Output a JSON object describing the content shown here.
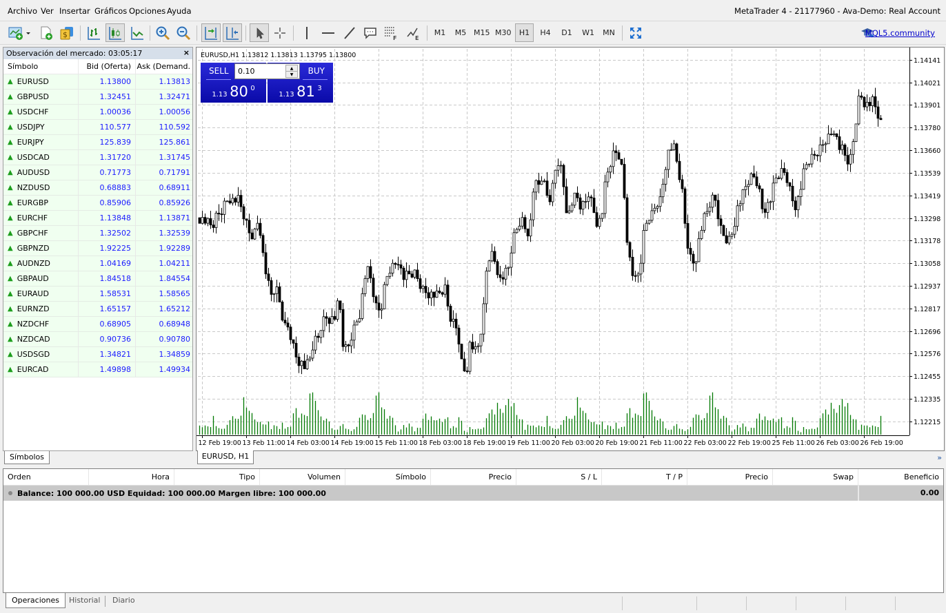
{
  "window": {
    "title": "MetaTrader 4 - 21177960 - Ava-Demo: Real Account"
  },
  "menu": [
    "Archivo",
    "Ver",
    "Insertar",
    "Gráficos",
    "Opciones",
    "Ayuda"
  ],
  "toolbar": {
    "icons": [
      "new-chart-icon",
      "new-profile-icon",
      "market-watch-icon",
      "bar-chart-icon",
      "candlestick-icon",
      "line-chart-icon",
      "zoom-in-icon",
      "zoom-out-icon",
      "auto-scroll-icon",
      "chart-shift-icon",
      "cursor-icon",
      "crosshair-icon",
      "vertical-line-icon",
      "horizontal-line-icon",
      "trendline-icon",
      "text-label-icon",
      "fibonacci-icon",
      "elliott-icon",
      "fullscreen-icon"
    ],
    "timeframes": [
      "M1",
      "M5",
      "M15",
      "M30",
      "H1",
      "H4",
      "D1",
      "W1",
      "MN"
    ],
    "active_timeframe": "H1",
    "community_link": "MQL5.community"
  },
  "market_watch": {
    "title": "Observación del mercado: 03:05:17",
    "close": "×",
    "columns": [
      "Símbolo",
      "Bid (Oferta)",
      "Ask (Demand."
    ],
    "rows": [
      {
        "symbol": "EURUSD",
        "bid": "1.13800",
        "ask": "1.13813"
      },
      {
        "symbol": "GBPUSD",
        "bid": "1.32451",
        "ask": "1.32471"
      },
      {
        "symbol": "USDCHF",
        "bid": "1.00036",
        "ask": "1.00056"
      },
      {
        "symbol": "USDJPY",
        "bid": "110.577",
        "ask": "110.592"
      },
      {
        "symbol": "EURJPY",
        "bid": "125.839",
        "ask": "125.861"
      },
      {
        "symbol": "USDCAD",
        "bid": "1.31720",
        "ask": "1.31745"
      },
      {
        "symbol": "AUDUSD",
        "bid": "0.71773",
        "ask": "0.71791"
      },
      {
        "symbol": "NZDUSD",
        "bid": "0.68883",
        "ask": "0.68911"
      },
      {
        "symbol": "EURGBP",
        "bid": "0.85906",
        "ask": "0.85926"
      },
      {
        "symbol": "EURCHF",
        "bid": "1.13848",
        "ask": "1.13871"
      },
      {
        "symbol": "GBPCHF",
        "bid": "1.32502",
        "ask": "1.32539"
      },
      {
        "symbol": "GBPNZD",
        "bid": "1.92225",
        "ask": "1.92289"
      },
      {
        "symbol": "AUDNZD",
        "bid": "1.04169",
        "ask": "1.04211"
      },
      {
        "symbol": "GBPAUD",
        "bid": "1.84518",
        "ask": "1.84554"
      },
      {
        "symbol": "EURAUD",
        "bid": "1.58531",
        "ask": "1.58565"
      },
      {
        "symbol": "EURNZD",
        "bid": "1.65157",
        "ask": "1.65212"
      },
      {
        "symbol": "NZDCHF",
        "bid": "0.68905",
        "ask": "0.68948"
      },
      {
        "symbol": "NZDCAD",
        "bid": "0.90736",
        "ask": "0.90780"
      },
      {
        "symbol": "USDSGD",
        "bid": "1.34821",
        "ask": "1.34859"
      },
      {
        "symbol": "EURCAD",
        "bid": "1.49898",
        "ask": "1.49934"
      }
    ],
    "tab": "Símbolos"
  },
  "chart": {
    "tab": "EURUSD, H1",
    "ohlc_label": "EURUSD,H1  1.13812 1.13813 1.13795 1.13800",
    "one_click": {
      "sell_label": "SELL",
      "buy_label": "BUY",
      "lot": "0.10",
      "sell_prefix": "1.13",
      "sell_big": "80",
      "sell_sup": "0",
      "buy_prefix": "1.13",
      "buy_big": "81",
      "buy_sup": "3"
    },
    "more": "»"
  },
  "chart_data": {
    "type": "candlestick",
    "title": "EURUSD,H1",
    "ylim": [
      1.1214,
      1.142
    ],
    "y_ticks": [
      "1.14141",
      "1.14021",
      "1.13901",
      "1.13780",
      "1.13660",
      "1.13539",
      "1.13419",
      "1.13298",
      "1.13178",
      "1.13058",
      "1.12937",
      "1.12817",
      "1.12696",
      "1.12576",
      "1.12455",
      "1.12335",
      "1.12215"
    ],
    "x_ticks": [
      "12 Feb 19:00",
      "13 Feb 11:00",
      "14 Feb 03:00",
      "14 Feb 19:00",
      "15 Feb 11:00",
      "18 Feb 03:00",
      "18 Feb 19:00",
      "19 Feb 11:00",
      "20 Feb 03:00",
      "20 Feb 19:00",
      "21 Feb 11:00",
      "22 Feb 03:00",
      "22 Feb 19:00",
      "25 Feb 11:00",
      "26 Feb 03:00",
      "26 Feb 19:00"
    ],
    "grid": true,
    "close_path": [
      1.133,
      1.1329,
      1.1327,
      1.1325,
      1.1331,
      1.1333,
      1.1338,
      1.1341,
      1.1339,
      1.134,
      1.1334,
      1.1327,
      1.132,
      1.1322,
      1.133,
      1.131,
      1.1296,
      1.1288,
      1.1293,
      1.1284,
      1.1272,
      1.1272,
      1.1263,
      1.1255,
      1.1253,
      1.125,
      1.1254,
      1.1264,
      1.1266,
      1.1275,
      1.1277,
      1.1276,
      1.1277,
      1.1287,
      1.126,
      1.126,
      1.1268,
      1.1274,
      1.128,
      1.1298,
      1.1302,
      1.129,
      1.1279,
      1.1283,
      1.1297,
      1.1303,
      1.1305,
      1.1308,
      1.1298,
      1.1299,
      1.13,
      1.13,
      1.1295,
      1.1291,
      1.129,
      1.1289,
      1.1288,
      1.129,
      1.1292,
      1.1278,
      1.1274,
      1.127,
      1.1252,
      1.1247,
      1.1265,
      1.1258,
      1.1262,
      1.1278,
      1.1308,
      1.1311,
      1.1306,
      1.1297,
      1.1299,
      1.1303,
      1.1318,
      1.1324,
      1.133,
      1.1324,
      1.1322,
      1.1348,
      1.1346,
      1.1352,
      1.1342,
      1.134,
      1.1355,
      1.1362,
      1.1348,
      1.133,
      1.1338,
      1.1342,
      1.1336,
      1.1337,
      1.1344,
      1.1335,
      1.1327,
      1.133,
      1.135,
      1.1358,
      1.1365,
      1.1364,
      1.1354,
      1.132,
      1.1302,
      1.1296,
      1.1301,
      1.1322,
      1.133,
      1.1332,
      1.1338,
      1.134,
      1.1357,
      1.1367,
      1.1368,
      1.1357,
      1.1345,
      1.132,
      1.1309,
      1.1305,
      1.1318,
      1.1328,
      1.1333,
      1.134,
      1.1339,
      1.1325,
      1.132,
      1.1318,
      1.1323,
      1.1335,
      1.134,
      1.1346,
      1.1351,
      1.1352,
      1.1348,
      1.1335,
      1.1336,
      1.134,
      1.135,
      1.1353,
      1.1355,
      1.135,
      1.134,
      1.1336,
      1.1345,
      1.1356,
      1.136,
      1.1362,
      1.1365,
      1.1368,
      1.1372,
      1.1374,
      1.1378,
      1.1368,
      1.1366,
      1.136,
      1.1362,
      1.138,
      1.1397,
      1.1392,
      1.139,
      1.1392,
      1.1387,
      1.138
    ],
    "volume_relative": [
      0.25,
      0.18,
      0.2,
      0.22,
      0.18,
      0.4,
      0.22,
      0.15,
      0.12,
      0.15,
      0.22,
      0.4,
      0.45,
      0.35,
      0.42,
      0.45,
      0.8,
      0.7,
      0.55,
      0.45,
      0.38,
      0.28,
      0.35,
      0.25,
      0.22,
      0.35,
      0.13,
      0.2,
      0.22,
      0.13,
      0.25,
      0.15,
      0.17,
      0.22,
      0.52,
      0.58,
      0.45,
      0.5,
      0.42,
      0.48,
      0.95,
      0.88,
      0.85,
      0.55,
      0.5,
      0.35,
      0.35,
      0.35,
      0.15,
      0.1,
      0.13,
      0.2,
      0.22,
      0.15,
      0.12,
      0.1,
      0.13,
      0.17,
      0.45,
      0.48,
      0.42,
      0.38,
      0.38,
      0.45,
      0.98,
      0.95,
      0.75,
      0.62,
      0.35,
      0.5,
      0.4,
      0.2,
      0.08,
      0.12,
      0.2,
      0.18,
      0.25,
      0.22,
      0.08,
      0.15,
      0.18,
      0.38,
      0.45,
      0.38,
      0.42,
      0.3,
      0.36,
      0.36,
      0.35,
      0.38,
      0.38,
      0.17,
      0.2,
      0.15,
      0.45,
      0.32,
      0.08,
      0.06,
      0.17,
      0.15,
      0.13,
      0.13,
      0.15,
      0.17,
      0.35,
      0.55,
      0.58,
      0.42,
      0.8,
      0.58,
      0.6,
      0.72,
      0.78,
      0.75,
      0.75,
      0.42,
      0.4,
      0.35,
      0.1,
      0.25,
      0.2
    ]
  },
  "terminal": {
    "columns": [
      "Orden",
      "Hora",
      "Tipo",
      "Volumen",
      "Símbolo",
      "Precio",
      "S / L",
      "T / P",
      "Precio",
      "Swap",
      "Beneficio"
    ],
    "balance_text": "Balance: 100 000.00 USD  Equidad: 100 000.00  Margen libre: 100 000.00",
    "profit": "0.00",
    "tabs": [
      "Operaciones",
      "Historial",
      "Diario"
    ],
    "active_tab": "Operaciones"
  }
}
